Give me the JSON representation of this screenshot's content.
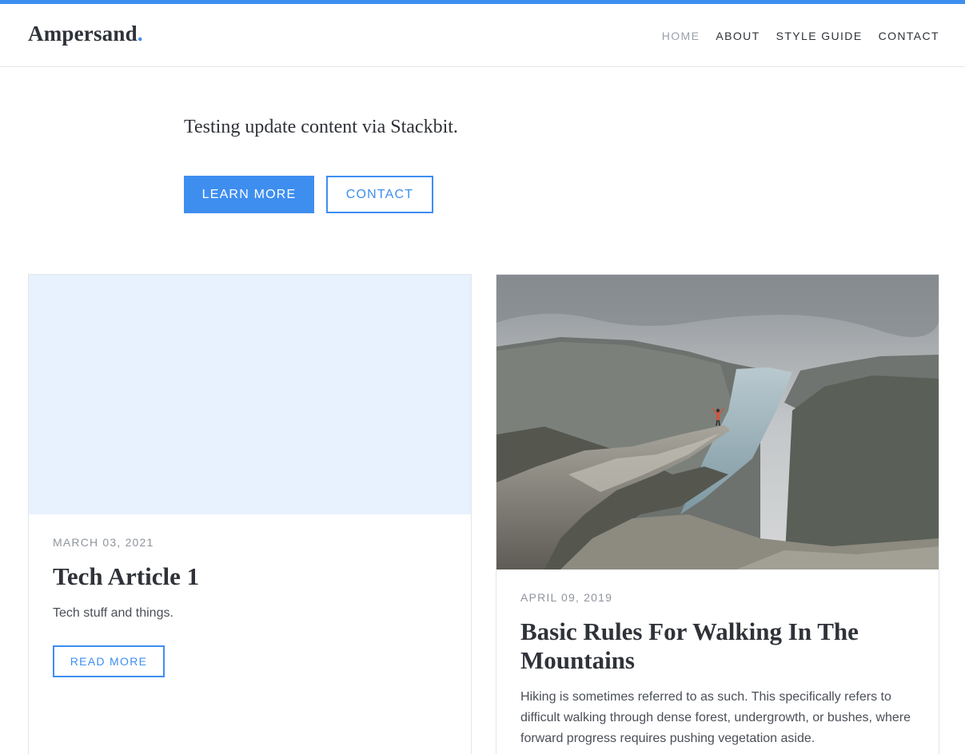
{
  "header": {
    "logo": "Ampersand",
    "logo_dot": ".",
    "nav": [
      {
        "label": "HOME",
        "active": true
      },
      {
        "label": "ABOUT",
        "active": false
      },
      {
        "label": "STYLE GUIDE",
        "active": false
      },
      {
        "label": "CONTACT",
        "active": false
      }
    ]
  },
  "hero": {
    "text": "Testing update content via Stackbit.",
    "buttons": {
      "primary": "LEARN MORE",
      "secondary": "CONTACT"
    }
  },
  "posts": [
    {
      "date": "MARCH 03, 2021",
      "title": "Tech Article 1",
      "excerpt": "Tech stuff and things.",
      "button": "READ MORE",
      "thumbnail": "blank"
    },
    {
      "date": "APRIL 09, 2019",
      "title": "Basic Rules For Walking In The Mountains",
      "excerpt": "Hiking is sometimes referred to as such. This specifically refers to difficult walking through dense forest, undergrowth, or bushes, where forward progress requires pushing vegetation aside.",
      "thumbnail": "mountain-fjord-photo"
    }
  ],
  "colors": {
    "accent": "#3e8ef0",
    "text": "#2f3238",
    "muted": "#8f959d",
    "thumb_blank": "#e8f1fe"
  }
}
